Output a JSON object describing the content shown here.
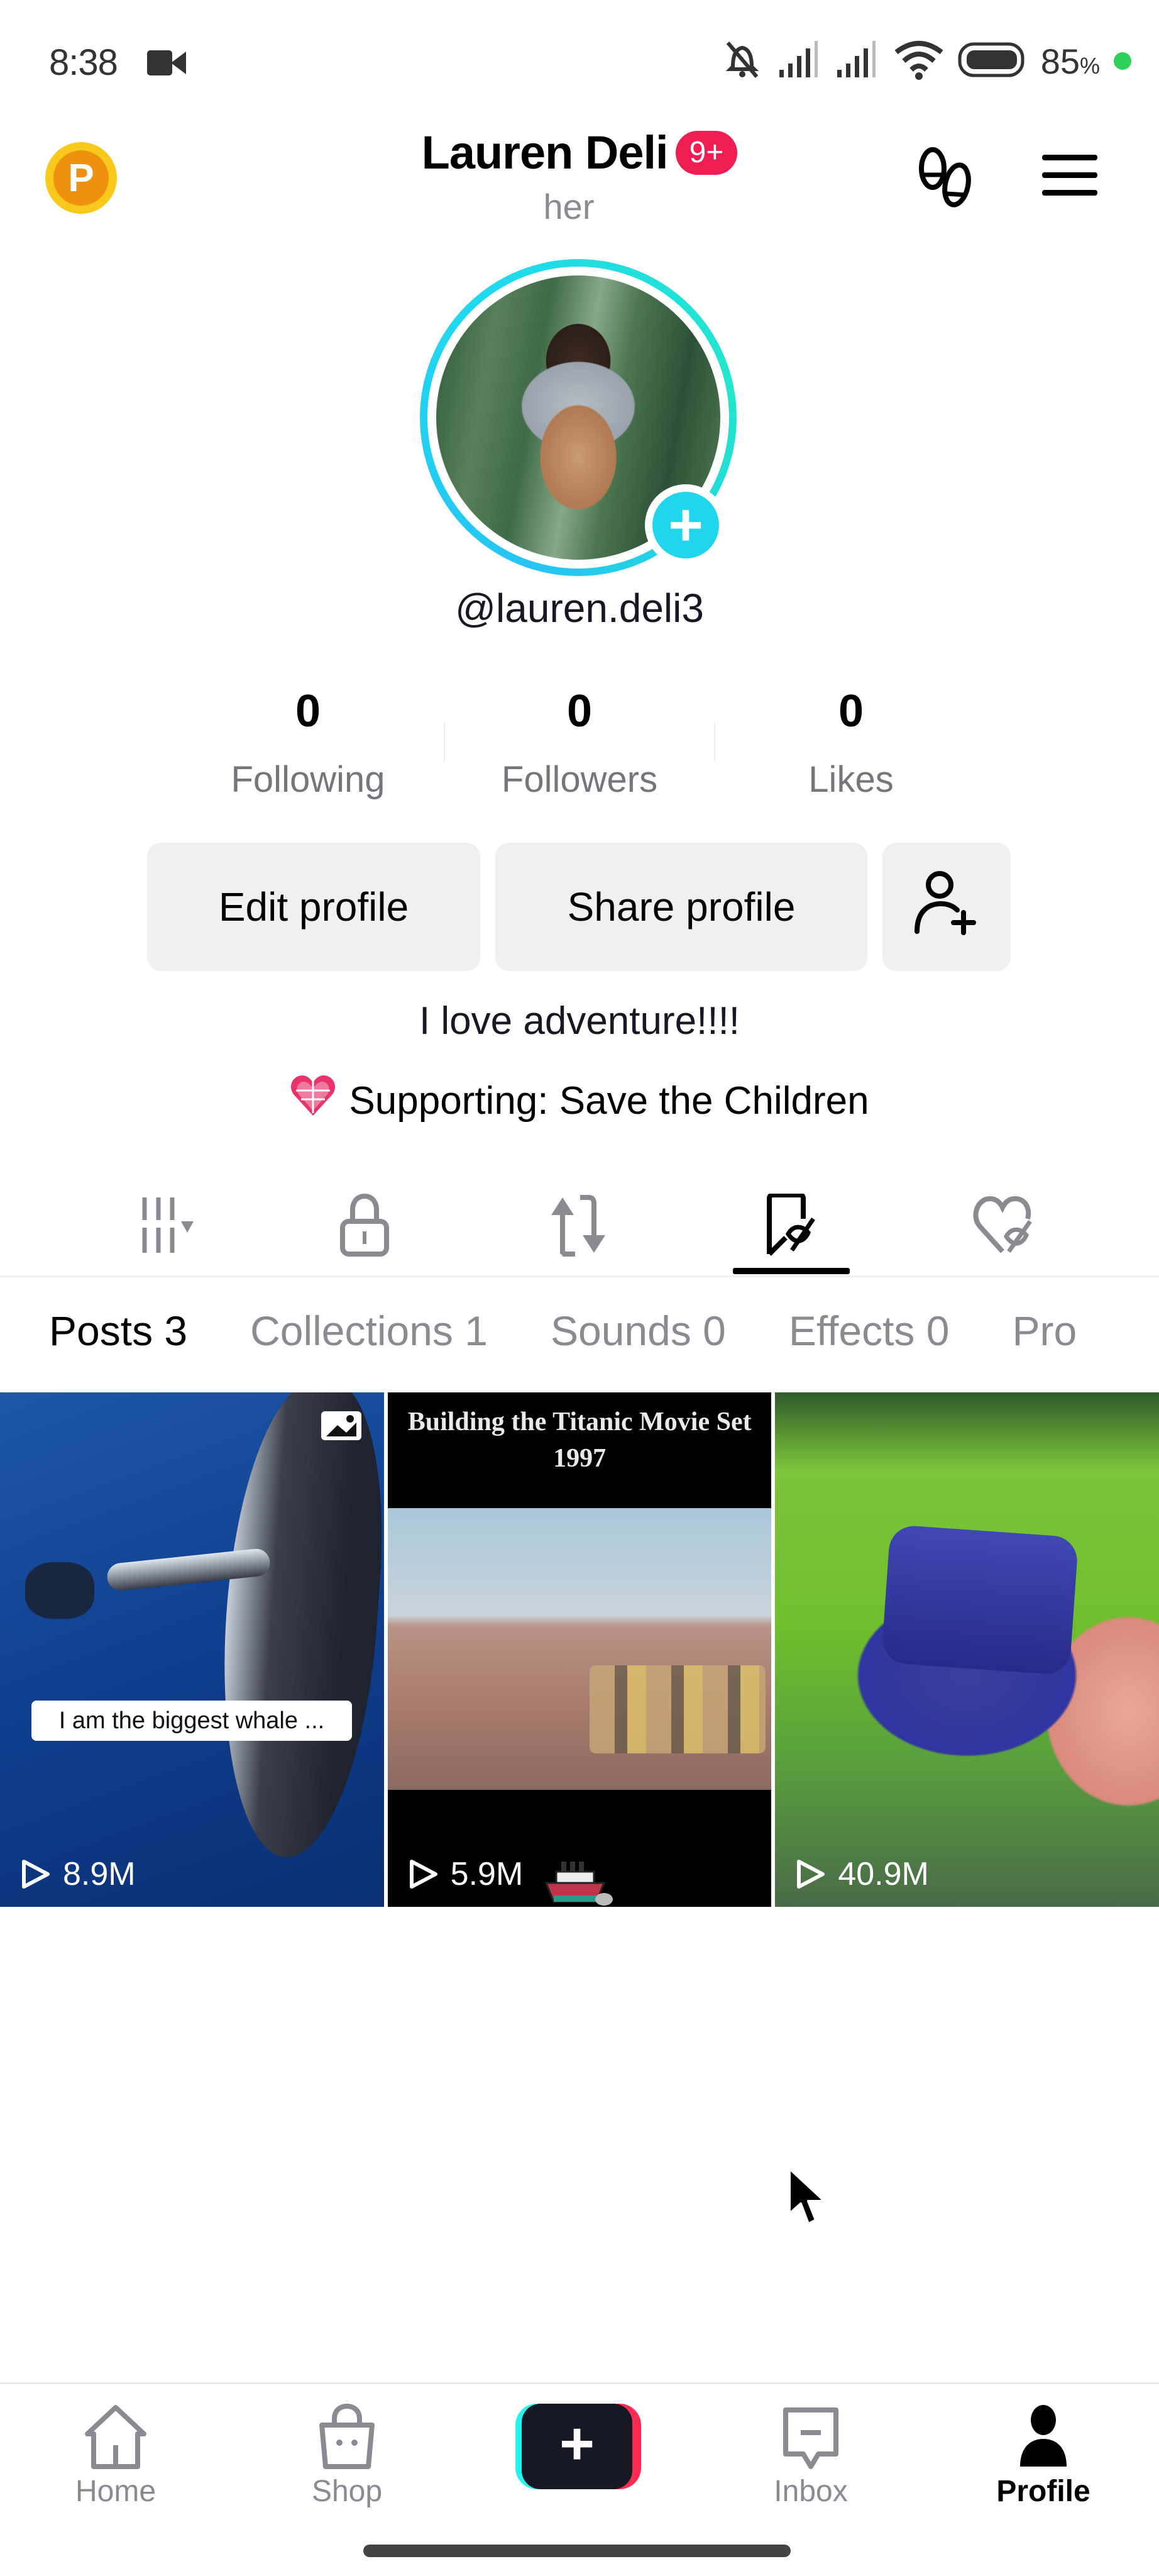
{
  "status_bar": {
    "time": "8:38",
    "battery_percent": "85",
    "battery_suffix": "%",
    "icons": [
      "screen-record-icon",
      "mute-icon",
      "signal-1-icon",
      "signal-2-icon",
      "wifi-icon",
      "battery-icon",
      "charging-dot"
    ]
  },
  "header": {
    "coin_letter": "P",
    "display_name": "Lauren Deli",
    "notification_badge": "9+",
    "pronouns": "her",
    "right_icons": [
      "footprints-icon",
      "menu-icon"
    ]
  },
  "profile": {
    "username": "@lauren.deli3",
    "stats": [
      {
        "value": "0",
        "label": "Following"
      },
      {
        "value": "0",
        "label": "Followers"
      },
      {
        "value": "0",
        "label": "Likes"
      }
    ],
    "buttons": {
      "edit": "Edit profile",
      "share": "Share profile"
    },
    "bio": "I love adventure!!!!",
    "supporting": "Supporting: Save the Children"
  },
  "icon_tabs": [
    {
      "name": "grid-sort-icon",
      "active": false
    },
    {
      "name": "lock-icon",
      "active": false
    },
    {
      "name": "repost-icon",
      "active": false
    },
    {
      "name": "bookmark-hidden-icon",
      "active": true
    },
    {
      "name": "heart-hidden-icon",
      "active": false
    }
  ],
  "text_tabs": [
    {
      "label": "Posts 3",
      "active": true
    },
    {
      "label": "Collections 1",
      "active": false
    },
    {
      "label": "Sounds 0",
      "active": false
    },
    {
      "label": "Effects 0",
      "active": false
    },
    {
      "label": "Pro",
      "active": false
    }
  ],
  "posts": [
    {
      "caption": "I am the biggest whale ...",
      "views": "8.9M",
      "type": "photo"
    },
    {
      "caption": "Building the Titanic Movie Set 1997",
      "views": "5.9M",
      "type": "video"
    },
    {
      "caption": "",
      "views": "40.9M",
      "type": "video"
    }
  ],
  "bottom_nav": [
    {
      "label": "Home",
      "active": false
    },
    {
      "label": "Shop",
      "active": false
    },
    {
      "label": "",
      "active": false
    },
    {
      "label": "Inbox",
      "active": false
    },
    {
      "label": "Profile",
      "active": true
    }
  ],
  "colors": {
    "accent_pink": "#ee1d52",
    "accent_cyan": "#20d5ec",
    "active_text": "#000000",
    "inactive_text": "#8a8b91"
  }
}
